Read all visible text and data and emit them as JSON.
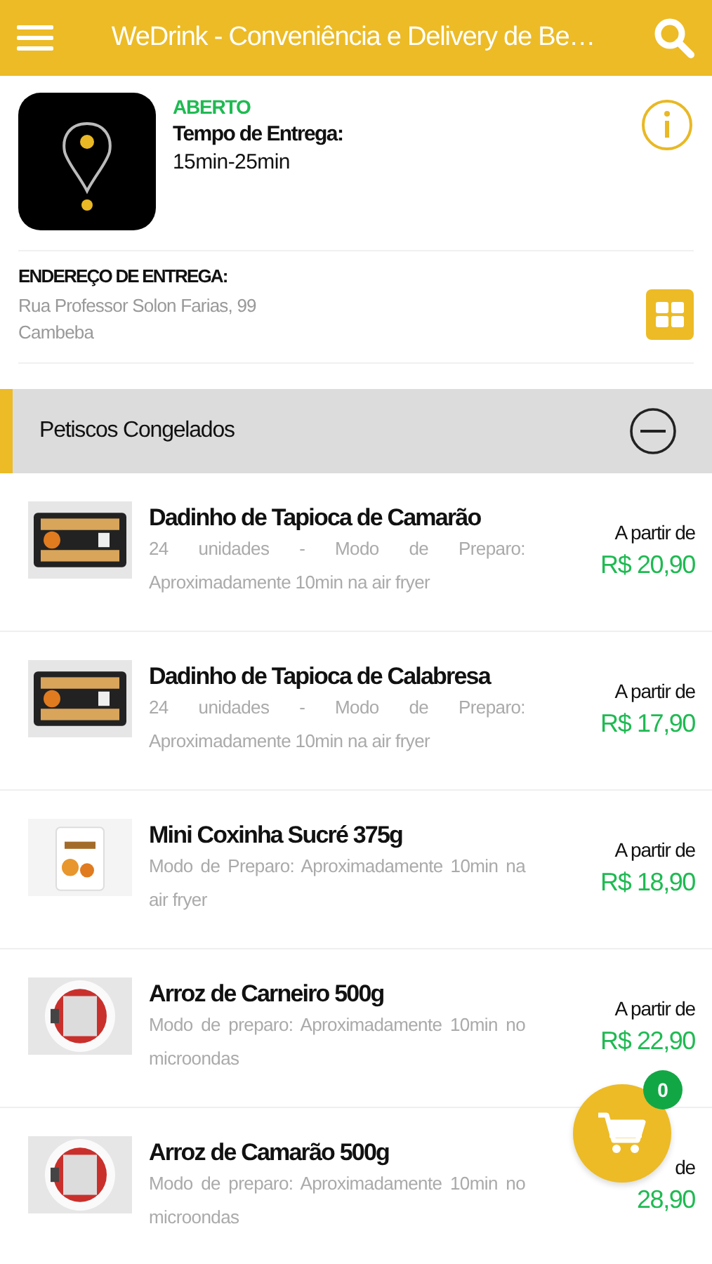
{
  "header": {
    "title": "WeDrink - Conveniência e Delivery de Be…"
  },
  "store": {
    "status": "ABERTO",
    "open": true,
    "delivery_label": "Tempo de Entrega:",
    "delivery_time": "15min-25min",
    "address_label": "ENDEREÇO DE ENTREGA:",
    "address_lines": [
      "Rua Professor Solon Farias, 99",
      "Cambeba"
    ]
  },
  "category": {
    "name": "Petiscos Congelados",
    "expanded": true
  },
  "products": [
    {
      "name": "Dadinho de Tapioca de Camarão",
      "description": "24 unidades - Modo de Preparo: Aproximadamente 10min na air fryer",
      "price_label": "A partir de",
      "price": "R$ 20,90"
    },
    {
      "name": "Dadinho de Tapioca de Calabresa",
      "description": "24 unidades - Modo de Preparo: Aproximadamente 10min na air fryer",
      "price_label": "A partir de",
      "price": "R$ 17,90"
    },
    {
      "name": "Mini Coxinha Sucré 375g",
      "description": "Modo de Preparo: Aproximadamente 10min na air fryer",
      "price_label": "A partir de",
      "price": "R$ 18,90"
    },
    {
      "name": "Arroz de Carneiro 500g",
      "description": "Modo de preparo: Aproximadamente 10min no microondas",
      "price_label": "A partir de",
      "price": "R$ 22,90"
    },
    {
      "name": "Arroz de Camarão 500g",
      "description": "Modo de preparo: Aproximadamente 10min no microondas",
      "price_label": "de",
      "price": "28,90"
    }
  ],
  "cart": {
    "count": "0"
  }
}
